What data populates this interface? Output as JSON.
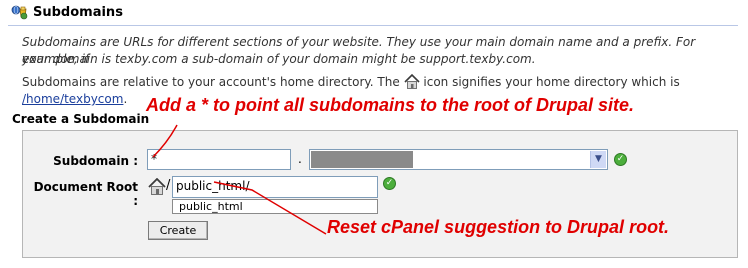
{
  "header": {
    "title": "Subdomains"
  },
  "intro": {
    "line1": "Subdomains are URLs for different sections of your website. They use your main domain name and a prefix. For example, if",
    "line2": "your domain is texby.com a sub-domain of your domain might be support.texby.com.",
    "relative_before": "Subdomains are relative to your account's home directory. The",
    "relative_after": "icon signifies your home directory which is",
    "home_path": "/home/texbycom",
    "home_path_suffix": "."
  },
  "create": {
    "section_title": "Create a Subdomain",
    "subdomain_label": "Subdomain :",
    "subdomain_value": "*",
    "dot": ".",
    "docroot_label": "Document Root :",
    "docroot_separator": "/",
    "docroot_value": "public_html/",
    "suggestion": "public_html",
    "create_button": "Create"
  },
  "annotations": {
    "top": "Add a * to point all subdomains to the root of Drupal site.",
    "bottom": "Reset cPanel suggestion to Drupal root."
  },
  "colors": {
    "annotation": "#e00000",
    "link": "#1b3f9c",
    "ok": "#4cae3c"
  },
  "icons": [
    "subdomains-icon",
    "home-icon",
    "check-icon",
    "chevron-down-icon"
  ]
}
